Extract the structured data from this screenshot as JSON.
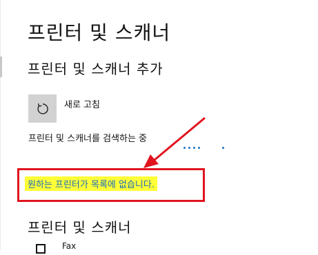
{
  "page": {
    "title": "프린터 및 스캐너"
  },
  "add_section": {
    "title": "프린터 및 스캐너 추가",
    "refresh_label": "새로 고침",
    "refresh_icon": "refresh-icon",
    "searching_text": "프린터 및 스캐너를 검색하는 중",
    "not_listed_link": "원하는 프린터가 목록에 없습니다."
  },
  "list_section": {
    "title": "프린터 및 스캐너",
    "items": [
      {
        "label": "Fax",
        "icon": "fax-icon"
      }
    ]
  },
  "colors": {
    "highlight": "#ffff38",
    "annotation": "#e0141e",
    "link": "#1a6bb8",
    "accent": "#1a73c7"
  }
}
